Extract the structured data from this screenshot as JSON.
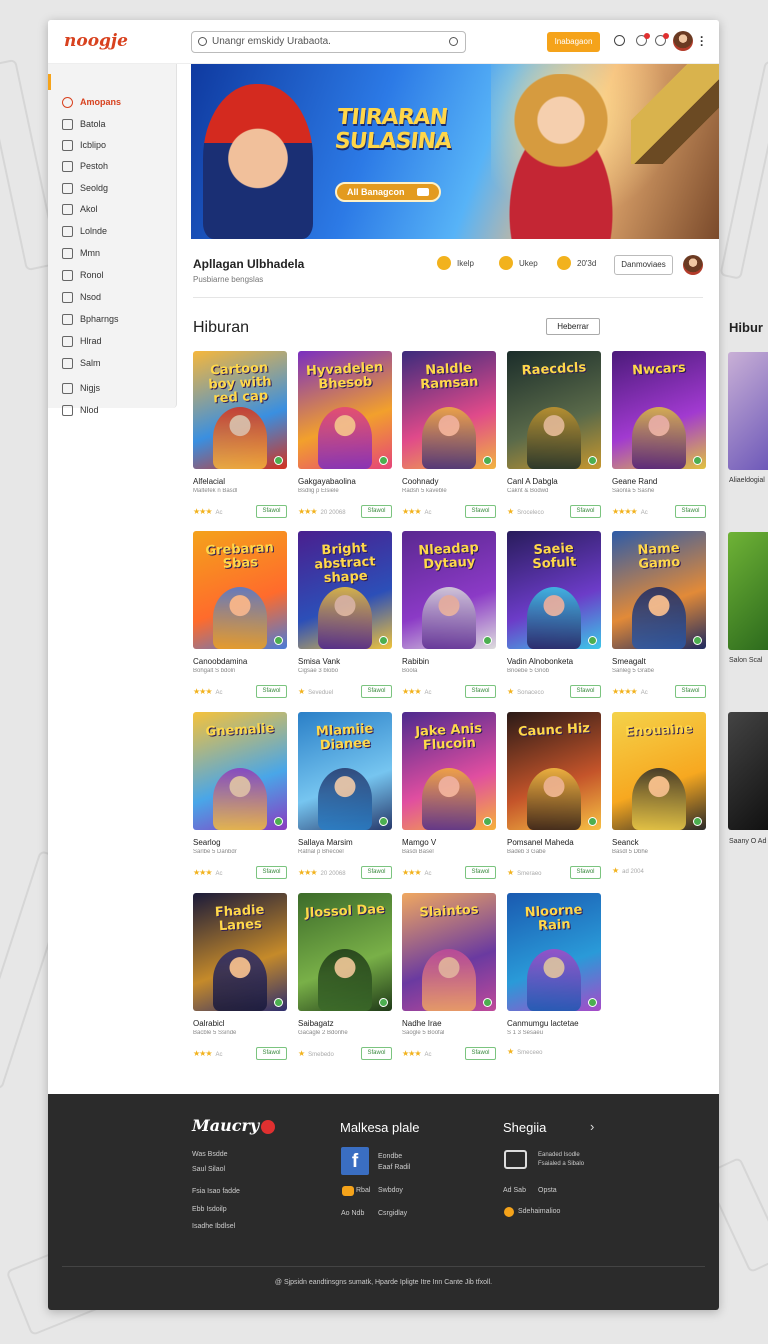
{
  "header": {
    "logo": "noogje",
    "search_placeholder": "Unangr emskidy Urabaota.",
    "button_label": "Inabagaon"
  },
  "sidebar": {
    "items": [
      {
        "label": "Amopans",
        "icon": "lightning-icon",
        "active": true
      },
      {
        "label": "Batola",
        "icon": "home-icon"
      },
      {
        "label": "Icblipo",
        "icon": "calendar-icon"
      },
      {
        "label": "Pestoh",
        "icon": "folder-icon"
      },
      {
        "label": "Seoldg",
        "icon": "settings-icon"
      },
      {
        "label": "Akol",
        "icon": "pen-icon"
      },
      {
        "label": "Lolnde",
        "icon": "folder-yellow-icon"
      },
      {
        "label": "Mmn",
        "icon": "clock-icon"
      },
      {
        "label": "Ronol",
        "icon": "stack-icon"
      },
      {
        "label": "Nsod",
        "icon": "red-circle-icon"
      },
      {
        "label": "Bpharngs",
        "icon": "target-icon"
      },
      {
        "label": "Hlrad",
        "icon": "wand-icon"
      },
      {
        "label": "Salm",
        "icon": "gear-icon"
      },
      {
        "label": "Nigjs",
        "icon": "tag-icon"
      },
      {
        "label": "Nlod",
        "icon": "ai-icon",
        "prefix": "A/I"
      }
    ]
  },
  "banner": {
    "title_line1": "TIIRARAN",
    "title_line2": "SULASINA",
    "cta_label": "All Banagcon"
  },
  "app_info": {
    "title": "Apllagan Ulbhadela",
    "subtitle": "Pusbiarne bengslas",
    "stats": [
      "Ikelp",
      "Ukep",
      "20'3d"
    ],
    "button": "Danmoviaes"
  },
  "section": {
    "title": "Hiburan",
    "button": "Heberrar",
    "peek_title": "Hibur"
  },
  "cards": [
    {
      "title": "Alfelacial",
      "sub": "Maltefek n Basdl",
      "img": "Cartoon boy with red cap",
      "rating": "★★★",
      "meta": "Ac",
      "btn": "Sfawol"
    },
    {
      "title": "Gakgayabaolina",
      "sub": "Bsdlig p Elsiele",
      "img": "Hyvadelen Bhesob",
      "rating": "★★★",
      "meta": "20 20068",
      "btn": "Sfawol"
    },
    {
      "title": "Coohnady",
      "sub": "Radsh 5 kaveble",
      "img": "Naldle Ramsan",
      "rating": "★★★",
      "meta": "Ac",
      "btn": "Sfawol"
    },
    {
      "title": "Canl A Dabgla",
      "sub": "Caknt & Bodwd",
      "img": "Raecdcls",
      "rating": "★",
      "meta": "Sroceleco",
      "btn": "Sfawol"
    },
    {
      "title": "Geane Rand",
      "sub": "Saonla 5 Sashe",
      "img": "Nwcars",
      "rating": "★★★★",
      "meta": "Ac",
      "btn": "Sfawol"
    },
    {
      "title": "Canoobdamina",
      "sub": "Bohgalt S bdoln",
      "img": "Grebaran Sbas",
      "rating": "★★★",
      "meta": "Ac",
      "btn": "Sfawol"
    },
    {
      "title": "Smisa Vank",
      "sub": "Cigsae 3 blobo",
      "img": "Bright abstract shape",
      "rating": "★",
      "meta": "Seveduel",
      "btn": "Sfawol"
    },
    {
      "title": "Rabibin",
      "sub": "Boola",
      "img": "Nleadap Dytauy",
      "rating": "★★★",
      "meta": "Ac",
      "btn": "Sfawol"
    },
    {
      "title": "Vadin Alnobonketa",
      "sub": "Bnoebe 5 Gnob",
      "img": "Saeie Sofult",
      "rating": "★",
      "meta": "Sonaceco",
      "btn": "Sfawol"
    },
    {
      "title": "Smeagalt",
      "sub": "Sanleg 5 Grabe",
      "img": "Name Gamo",
      "rating": "★★★★",
      "meta": "Ac",
      "btn": "Sfawol"
    },
    {
      "title": "Searlog",
      "sub": "Sarlbe 5 Danbdr",
      "img": "Gnemalie",
      "rating": "★★★",
      "meta": "Ac",
      "btn": "Sfawol"
    },
    {
      "title": "Sallaya Marsim",
      "sub": "Ratnal p Bhecoel",
      "img": "Mlamiie Dianee",
      "rating": "★★★",
      "meta": "20 20068",
      "btn": "Sfawol"
    },
    {
      "title": "Mamgo V",
      "sub": "Basdi Basel",
      "img": "Jake Anis Flucoin",
      "rating": "★★★",
      "meta": "Ac",
      "btn": "Sfawol"
    },
    {
      "title": "Pomsanel Maheda",
      "sub": "Badeb 3 Gabe",
      "img": "Caunc Hiz",
      "rating": "★",
      "meta": "Smeraeo",
      "btn": "Sfawol"
    },
    {
      "title": "Seanck",
      "sub": "Basdl 5 Dbhe",
      "img": "Enouaine",
      "rating": "★",
      "meta": "ad 2004",
      "btn": ""
    },
    {
      "title": "Oalrabicl",
      "sub": "Bacble 5 Ssinde",
      "img": "Fhadie Lanes",
      "rating": "★★★",
      "meta": "Ac",
      "btn": "Sfawol"
    },
    {
      "title": "Saibagatz",
      "sub": "Gacagle 2 Bdonhe",
      "img": "Jlossol Dae",
      "rating": "★",
      "meta": "Smebedo",
      "btn": "Sfawol"
    },
    {
      "title": "Nadhe Irae",
      "sub": "Saogle 5 Boofal",
      "img": "Slaintos",
      "rating": "★★★",
      "meta": "Ac",
      "btn": "Sfawol"
    },
    {
      "title": "Canmumgu lactetae",
      "sub": "S 1 3 Sesaeu",
      "img": "Nloorne Rain",
      "rating": "★",
      "meta": "Smeceeo",
      "btn": ""
    }
  ],
  "peek_cards": [
    {
      "title": "Aliaeldogial",
      "sub": "Baslary 5 Spcol"
    },
    {
      "title": "Salon Scal",
      "sub": "Soelin 5 Doan"
    },
    {
      "title": "Saany O Ad",
      "sub": "ad 2004"
    }
  ],
  "footer": {
    "logo": "Maucry",
    "col1": [
      "Was Bsdde",
      "Saul Silaol",
      "Fsia Isao fadde",
      "Ebb Isdoilp",
      "Isadhe Ibdlsel"
    ],
    "col2_title": "Malkesa plale",
    "col2_items": [
      "Eondbe Eaaf Radil",
      "Swbdoy",
      "Csrgidlay"
    ],
    "col2_prefix": [
      "Rbal",
      "Ao Ndb"
    ],
    "col3_title": "Shegiia",
    "col3_items": [
      "Eanaded Isodle Fsaialed a Sibalo",
      "Ad Sab",
      "Sdehaimalioo"
    ],
    "col3_extra": "Opsta",
    "copyright": "@ Sjpsidn eandtinsgns sumatk, Hparde Ipligte Itre Inn Cante Jib tfxoll."
  },
  "colors": {
    "accent": "#f5a31a",
    "brand": "#d8421f",
    "footer_bg": "#2b2b2b",
    "get_border": "#7bc47f"
  }
}
